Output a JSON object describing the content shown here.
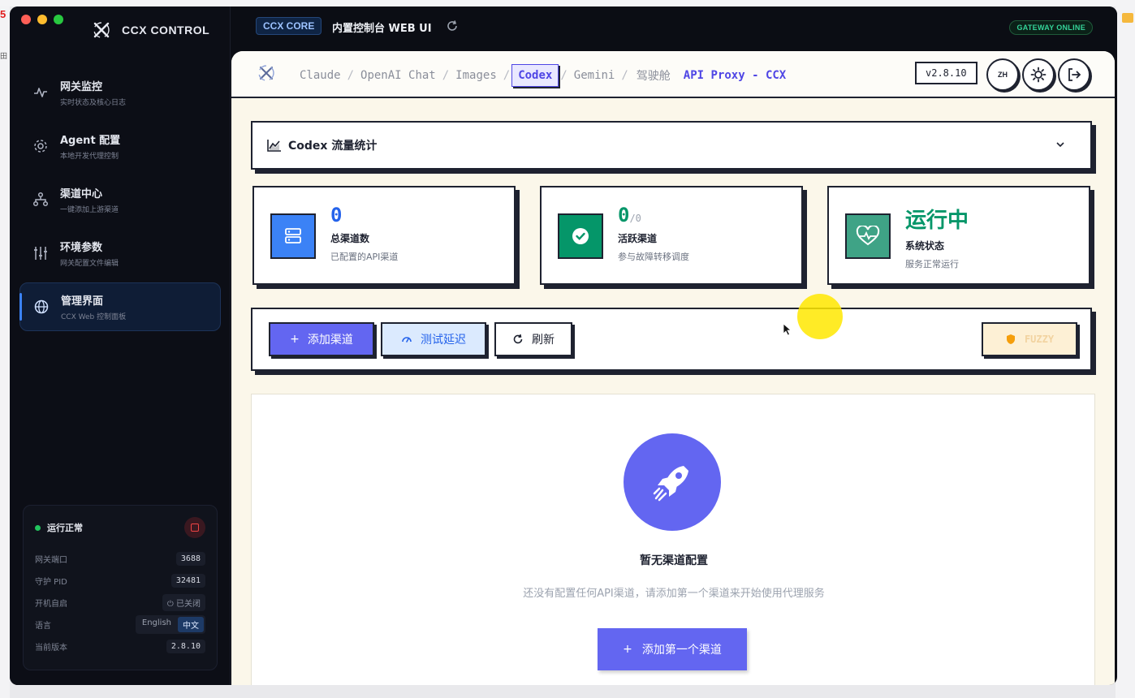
{
  "desktop": {
    "left_tag": "5",
    "left_tag2": "田"
  },
  "sidebar": {
    "brand": "CCX CONTROL",
    "items": [
      {
        "title": "网关监控",
        "sub": "实时状态及核心日志",
        "icon": "activity-icon"
      },
      {
        "title": "Agent 配置",
        "sub": "本地开发代理控制",
        "icon": "gear-icon"
      },
      {
        "title": "渠道中心",
        "sub": "一键添加上游渠道",
        "icon": "network-icon"
      },
      {
        "title": "环境参数",
        "sub": "网关配置文件编辑",
        "icon": "sliders-icon"
      },
      {
        "title": "管理界面",
        "sub": "CCX Web 控制面板",
        "icon": "globe-icon",
        "active": true
      }
    ],
    "status": {
      "label": "运行正常",
      "rows": {
        "port_key": "网关端口",
        "port_val": "3688",
        "pid_key": "守护 PID",
        "pid_val": "32481",
        "autostart_key": "开机自启",
        "autostart_val": "已关闭",
        "lang_key": "语言",
        "lang_en": "English",
        "lang_zh": "中文",
        "version_key": "当前版本",
        "version_val": "2.8.10"
      }
    }
  },
  "topbar": {
    "core_badge": "CCX CORE",
    "title": "内置控制台 WEB UI",
    "gateway": "GATEWAY ONLINE"
  },
  "tabs": {
    "items": [
      "Claude",
      "OpenAI Chat",
      "Images",
      "Codex",
      "Gemini"
    ],
    "active": "Codex",
    "cockpit": "驾驶舱",
    "api_title": "API Proxy - CCX",
    "version": "v2.8.10",
    "lang_btn": "ZH"
  },
  "stats_header": "Codex  流量统计",
  "stats": [
    {
      "value": "0",
      "label": "总渠道数",
      "desc": "已配置的API渠道",
      "color": "#2563eb"
    },
    {
      "value": "0",
      "of": "/0",
      "label": "活跃渠道",
      "desc": "参与故障转移调度",
      "color": "#059669"
    },
    {
      "value": "运行中",
      "label": "系统状态",
      "desc": "服务正常运行",
      "color": "#059669"
    }
  ],
  "toolbar": {
    "add": "添加渠道",
    "test": "测试延迟",
    "refresh": "刷新",
    "fuzzy": "FUZZY"
  },
  "empty": {
    "title": "暂无渠道配置",
    "desc": "还没有配置任何API渠道，请添加第一个渠道来开始使用代理服务",
    "button": "添加第一个渠道"
  }
}
